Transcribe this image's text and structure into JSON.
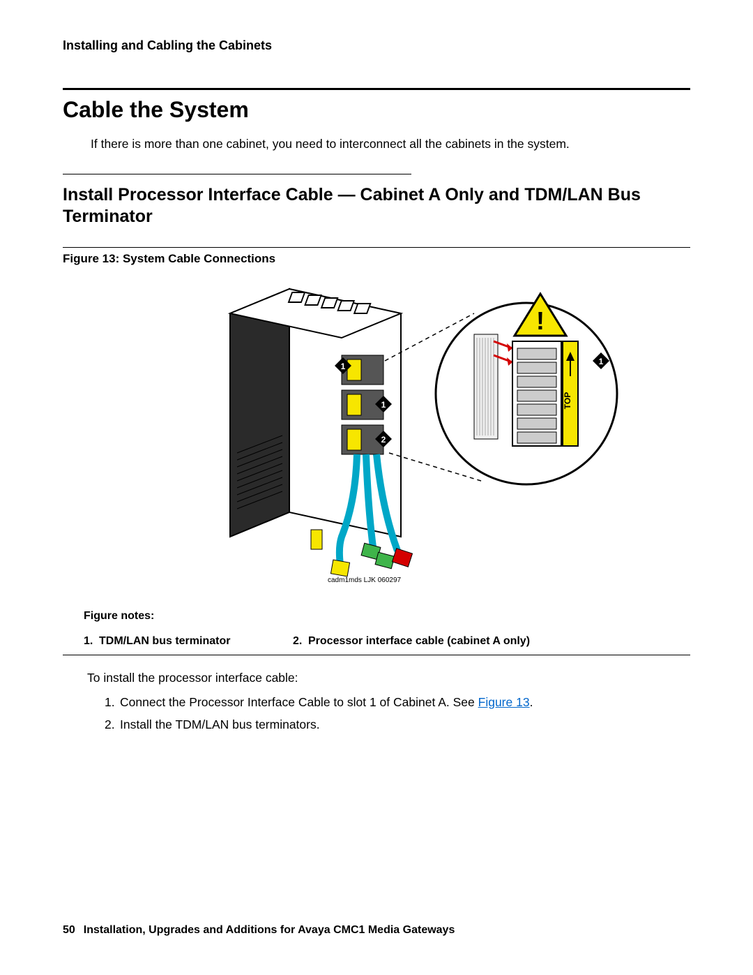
{
  "header": {
    "running_head": "Installing and Cabling the Cabinets"
  },
  "section1": {
    "title": "Cable the System",
    "intro": "If there is more than one cabinet, you need to interconnect all the cabinets in the system."
  },
  "section2": {
    "title": "Install Processor Interface Cable — Cabinet A Only and TDM/LAN Bus Terminator"
  },
  "figure": {
    "title": "Figure 13: System Cable Connections",
    "small_ref": "cadm1mds LJK 060297",
    "callouts": {
      "one": "1",
      "two": "2",
      "top": "TOP"
    },
    "notes_label": "Figure notes:",
    "notes": [
      {
        "num": "1.",
        "text": "TDM/LAN bus terminator"
      },
      {
        "num": "2.",
        "text": "Processor interface cable (cabinet A only)"
      }
    ]
  },
  "body": {
    "lead": "To install the processor interface cable:",
    "steps": [
      {
        "num": "1.",
        "text_before": "Connect the Processor Interface Cable to slot 1 of Cabinet A. See ",
        "link": "Figure 13",
        "text_after": "."
      },
      {
        "num": "2.",
        "text_before": "Install the TDM/LAN bus terminators.",
        "link": "",
        "text_after": ""
      }
    ]
  },
  "footer": {
    "page_number": "50",
    "doc_title": "Installation, Upgrades and Additions for Avaya CMC1 Media Gateways"
  },
  "colors": {
    "link": "#0066cc",
    "highlight": "#f7e600",
    "accent_red": "#d40000",
    "accent_blue": "#00a7c7",
    "accent_green": "#3fb44a"
  }
}
